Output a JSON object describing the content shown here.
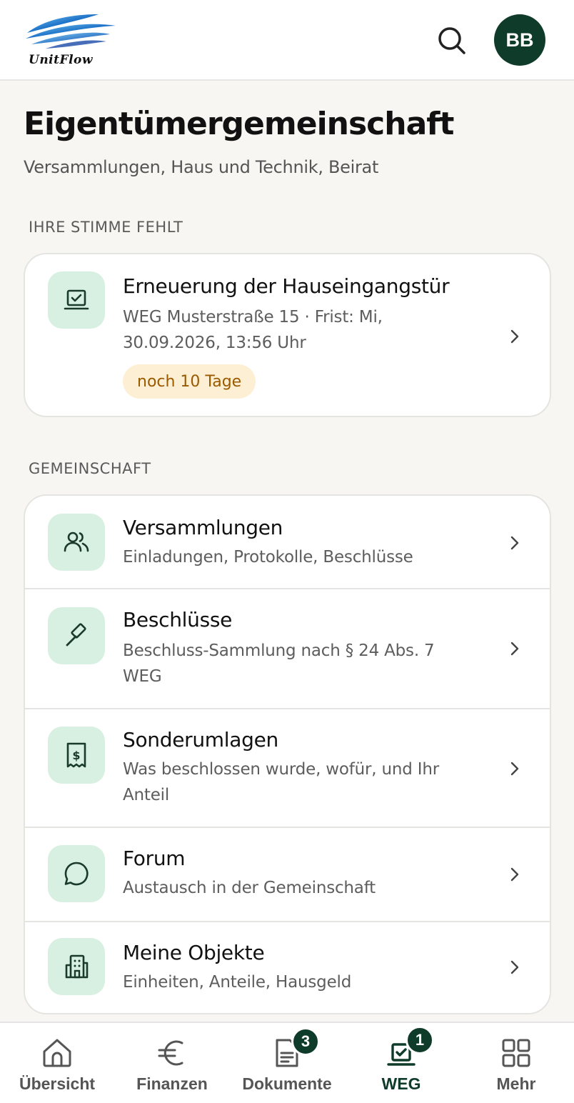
{
  "header": {
    "logo_text": "UnitFlow",
    "avatar_initials": "BB",
    "icons": {
      "search": "search-icon"
    },
    "colors": {
      "brand": "#0f3b2a",
      "background": "#f7f6f2",
      "icon_tile": "#d7f0e2"
    }
  },
  "page": {
    "title": "Eigentümergemeinschaft",
    "subtitle": "Versammlungen, Haus und Technik, Beirat"
  },
  "vote_section": {
    "label": "IHRE STIMME FEHLT",
    "item": {
      "title": "Erneuerung der Hauseingangstür",
      "subtitle": "WEG Musterstraße 15 · Frist: Mi, 30.09.2026, 13:56 Uhr",
      "badge": "noch 10 Tage",
      "icon": "ballot-icon"
    }
  },
  "community_section": {
    "label": "GEMEINSCHAFT",
    "items": [
      {
        "title": "Versammlungen",
        "subtitle": "Einladungen, Protokolle, Beschlüsse",
        "icon": "users-icon"
      },
      {
        "title": "Beschlüsse",
        "subtitle": "Beschluss-Sammlung nach § 24 Abs. 7 WEG",
        "icon": "gavel-icon"
      },
      {
        "title": "Sonderumlagen",
        "subtitle": "Was beschlossen wurde, wofür, und Ihr Anteil",
        "icon": "receipt-icon"
      },
      {
        "title": "Forum",
        "subtitle": "Austausch in der Gemeinschaft",
        "icon": "chat-icon"
      },
      {
        "title": "Meine Objekte",
        "subtitle": "Einheiten, Anteile, Hausgeld",
        "icon": "building-icon"
      }
    ]
  },
  "nav": {
    "items": [
      {
        "label": "Übersicht",
        "icon": "home-icon",
        "badge": ""
      },
      {
        "label": "Finanzen",
        "icon": "euro-icon",
        "badge": ""
      },
      {
        "label": "Dokumente",
        "icon": "document-icon",
        "badge": "3"
      },
      {
        "label": "WEG",
        "icon": "ballot-icon",
        "badge": "1",
        "active": true
      },
      {
        "label": "Mehr",
        "icon": "grid-icon",
        "badge": ""
      }
    ]
  }
}
